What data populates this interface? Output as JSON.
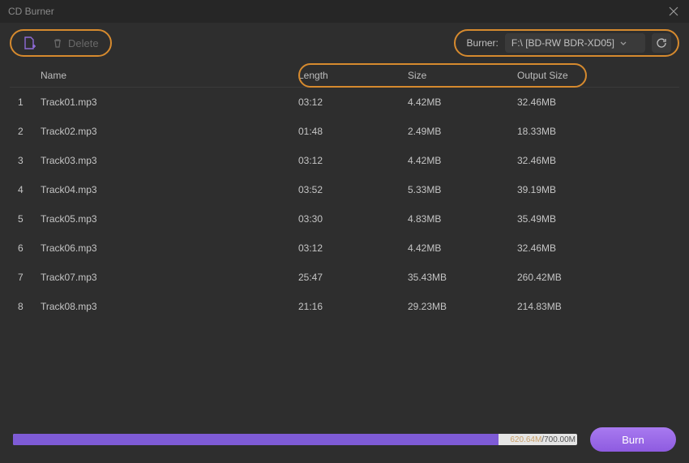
{
  "window": {
    "title": "CD Burner"
  },
  "toolbar": {
    "delete_label": "Delete",
    "burner_label": "Burner:",
    "burner_value": "F:\\ [BD-RW  BDR-XD05]"
  },
  "columns": {
    "name": "Name",
    "length": "Length",
    "size": "Size",
    "output": "Output Size"
  },
  "tracks": [
    {
      "idx": "1",
      "name": "Track01.mp3",
      "length": "03:12",
      "size": "4.42MB",
      "output": "32.46MB"
    },
    {
      "idx": "2",
      "name": "Track02.mp3",
      "length": "01:48",
      "size": "2.49MB",
      "output": "18.33MB"
    },
    {
      "idx": "3",
      "name": "Track03.mp3",
      "length": "03:12",
      "size": "4.42MB",
      "output": "32.46MB"
    },
    {
      "idx": "4",
      "name": "Track04.mp3",
      "length": "03:52",
      "size": "5.33MB",
      "output": "39.19MB"
    },
    {
      "idx": "5",
      "name": "Track05.mp3",
      "length": "03:30",
      "size": "4.83MB",
      "output": "35.49MB"
    },
    {
      "idx": "6",
      "name": "Track06.mp3",
      "length": "03:12",
      "size": "4.42MB",
      "output": "32.46MB"
    },
    {
      "idx": "7",
      "name": "Track07.mp3",
      "length": "25:47",
      "size": "35.43MB",
      "output": "260.42MB"
    },
    {
      "idx": "8",
      "name": "Track08.mp3",
      "length": "21:16",
      "size": "29.23MB",
      "output": "214.83MB"
    }
  ],
  "footer": {
    "used": "620.64M",
    "sep": "/",
    "total": "700.00M",
    "burn_label": "Burn",
    "fill_percent": 86
  }
}
